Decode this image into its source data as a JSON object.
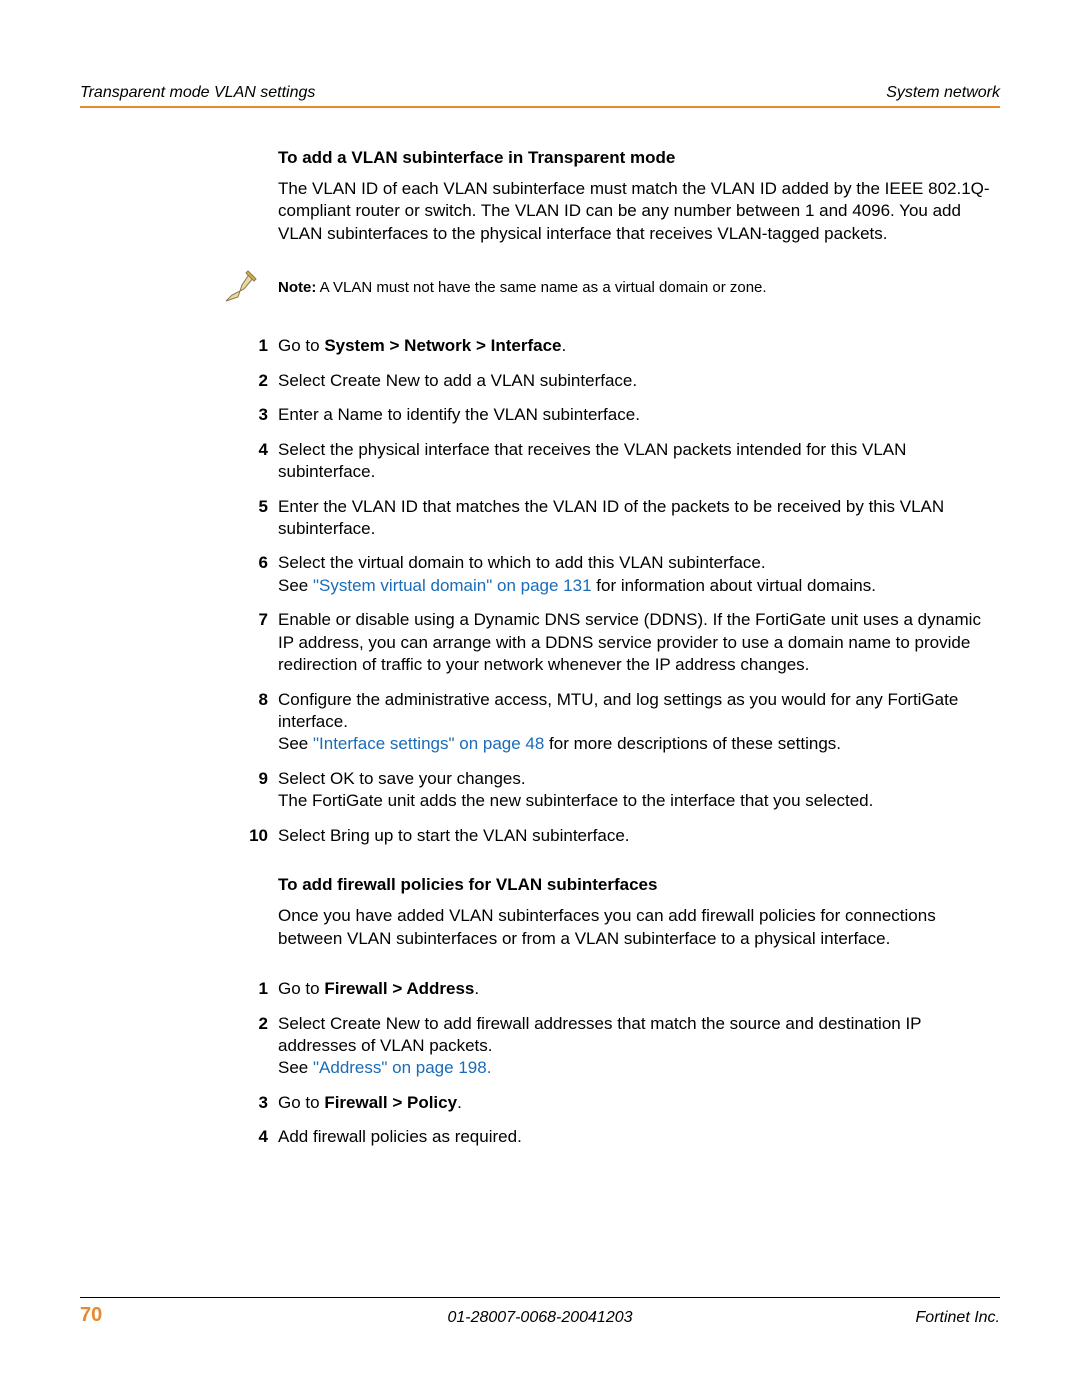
{
  "header": {
    "left": "Transparent mode VLAN settings",
    "right": "System network"
  },
  "section1": {
    "title": "To add a VLAN subinterface in Transparent mode",
    "intro": "The VLAN ID of each VLAN subinterface must match the VLAN ID added by the IEEE 802.1Q-compliant router or switch. The VLAN ID can be any number between 1 and 4096. You add VLAN subinterfaces to the physical interface that receives VLAN-tagged packets.",
    "note_label": "Note:",
    "note_text": " A VLAN must not have the same name as a virtual domain or zone.",
    "steps": {
      "s1_prefix": "Go to ",
      "s1_bold": "System > Network > Interface",
      "s1_suffix": ".",
      "s2": "Select Create New to add a VLAN subinterface.",
      "s3": "Enter a Name to identify the VLAN subinterface.",
      "s4": "Select the physical interface that receives the VLAN packets intended for this VLAN subinterface.",
      "s5": "Enter the VLAN ID that matches the VLAN ID of the packets to be received by this VLAN subinterface.",
      "s6_line1": "Select the virtual domain to which to add this VLAN subinterface.",
      "s6_see": "See ",
      "s6_link": "\"System virtual domain\" on page 131",
      "s6_after": " for information about virtual domains.",
      "s7": "Enable or disable using a Dynamic DNS service (DDNS). If the FortiGate unit uses a dynamic IP address, you can arrange with a DDNS service provider to use a domain name to provide redirection of traffic to your network whenever the IP address changes.",
      "s8_line1": "Configure the administrative access, MTU, and log settings as you would for any FortiGate interface.",
      "s8_see": "See ",
      "s8_link": "\"Interface settings\" on page 48",
      "s8_after": " for more descriptions of these settings.",
      "s9_line1": "Select OK to save your changes.",
      "s9_line2": "The FortiGate unit adds the new subinterface to the interface that you selected.",
      "s10": "Select Bring up to start the VLAN subinterface."
    }
  },
  "section2": {
    "title": "To add firewall policies for VLAN subinterfaces",
    "intro": "Once you have added VLAN subinterfaces you can add firewall policies for connections between VLAN subinterfaces or from a VLAN subinterface to a physical interface.",
    "steps": {
      "s1_prefix": "Go to ",
      "s1_bold": "Firewall > Address",
      "s1_suffix": ".",
      "s2_line1": "Select Create New to add firewall addresses that match the source and destination IP addresses of VLAN packets.",
      "s2_see": "See ",
      "s2_link": "\"Address\" on page 198",
      "s2_after": ".",
      "s3_prefix": "Go to ",
      "s3_bold": "Firewall > Policy",
      "s3_suffix": ".",
      "s4": "Add firewall policies as required."
    }
  },
  "footer": {
    "page": "70",
    "center": "01-28007-0068-20041203",
    "right": "Fortinet Inc."
  }
}
